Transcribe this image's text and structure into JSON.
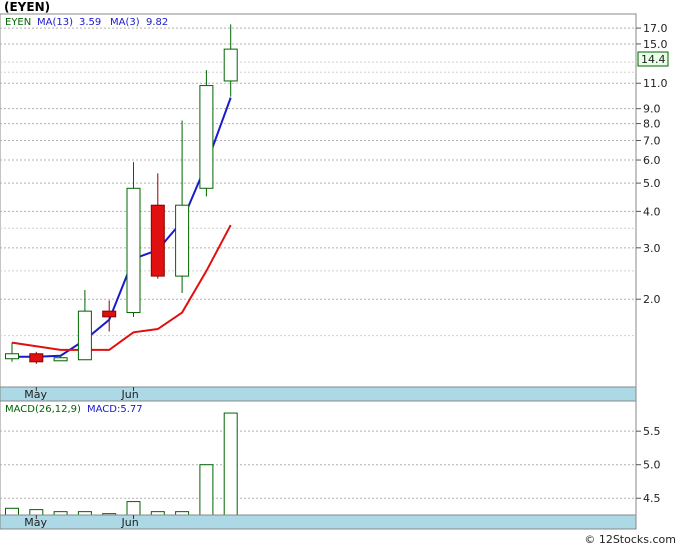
{
  "title": "(EYEN)",
  "footer": "© 12Stocks.com",
  "colors": {
    "ma13": "#1a1acc",
    "ma3": "#e01010",
    "up_candle": "#ffffff",
    "down_candle": "#e01010",
    "candle_stroke": "#006400",
    "grid": "#b0b0b0",
    "date_band": "#add8e6",
    "last_price_box": "#e8ffe8",
    "last_price_border": "#006400"
  },
  "legend": {
    "ticker": "EYEN",
    "ma13_label": "MA(13)",
    "ma13_value": "3.59",
    "ma3_label": "MA(3)",
    "ma3_value": "9.82"
  },
  "macd_legend": {
    "label": "MACD(26,12,9)",
    "value_label": "MACD:5.77"
  },
  "last_price_label": "14.4",
  "chart_data": [
    {
      "type": "candlestick",
      "scale": "log",
      "ylim": [
        1.0,
        19.0
      ],
      "y_ticks": [
        2.0,
        3.0,
        4.0,
        5.0,
        6.0,
        7.0,
        8.0,
        9.0,
        11.0,
        15.0,
        17.0
      ],
      "x_labels": [
        {
          "label": "May",
          "index": 1
        },
        {
          "label": "Jun",
          "index": 5
        }
      ],
      "grid": true,
      "candles": [
        {
          "open": 1.25,
          "close": 1.3,
          "high": 1.42,
          "low": 1.22
        },
        {
          "open": 1.3,
          "close": 1.22,
          "high": 1.32,
          "low": 1.2
        },
        {
          "open": 1.23,
          "close": 1.26,
          "high": 1.29,
          "low": 1.23
        },
        {
          "open": 1.24,
          "close": 1.82,
          "high": 2.15,
          "low": 1.24
        },
        {
          "open": 1.82,
          "close": 1.74,
          "high": 1.98,
          "low": 1.55
        },
        {
          "open": 1.8,
          "close": 4.8,
          "high": 5.9,
          "low": 1.74
        },
        {
          "open": 4.2,
          "close": 2.4,
          "high": 5.4,
          "low": 2.35
        },
        {
          "open": 2.4,
          "close": 4.2,
          "high": 8.2,
          "low": 2.1
        },
        {
          "open": 4.8,
          "close": 10.8,
          "high": 12.2,
          "low": 4.5
        },
        {
          "open": 11.2,
          "close": 14.4,
          "high": 17.5,
          "low": 9.9
        }
      ],
      "series": [
        {
          "name": "MA(13)",
          "values": [
            1.27,
            1.27,
            1.28,
            1.45,
            1.7,
            2.75,
            2.95,
            3.7,
            5.8,
            9.82
          ]
        },
        {
          "name": "MA(3)",
          "values": [
            1.42,
            1.38,
            1.34,
            1.34,
            1.34,
            1.54,
            1.58,
            1.8,
            2.5,
            3.59
          ]
        }
      ]
    },
    {
      "type": "bar",
      "title": "MACD(26,12,9)",
      "ylim": [
        4.25,
        5.95
      ],
      "y_ticks": [
        4.5,
        5.0,
        5.5
      ],
      "x_labels": [
        {
          "label": "May",
          "index": 1
        },
        {
          "label": "Jun",
          "index": 5
        }
      ],
      "grid": true,
      "values": [
        4.35,
        4.33,
        4.3,
        4.3,
        4.27,
        4.45,
        4.3,
        4.3,
        5.0,
        5.77
      ]
    }
  ]
}
